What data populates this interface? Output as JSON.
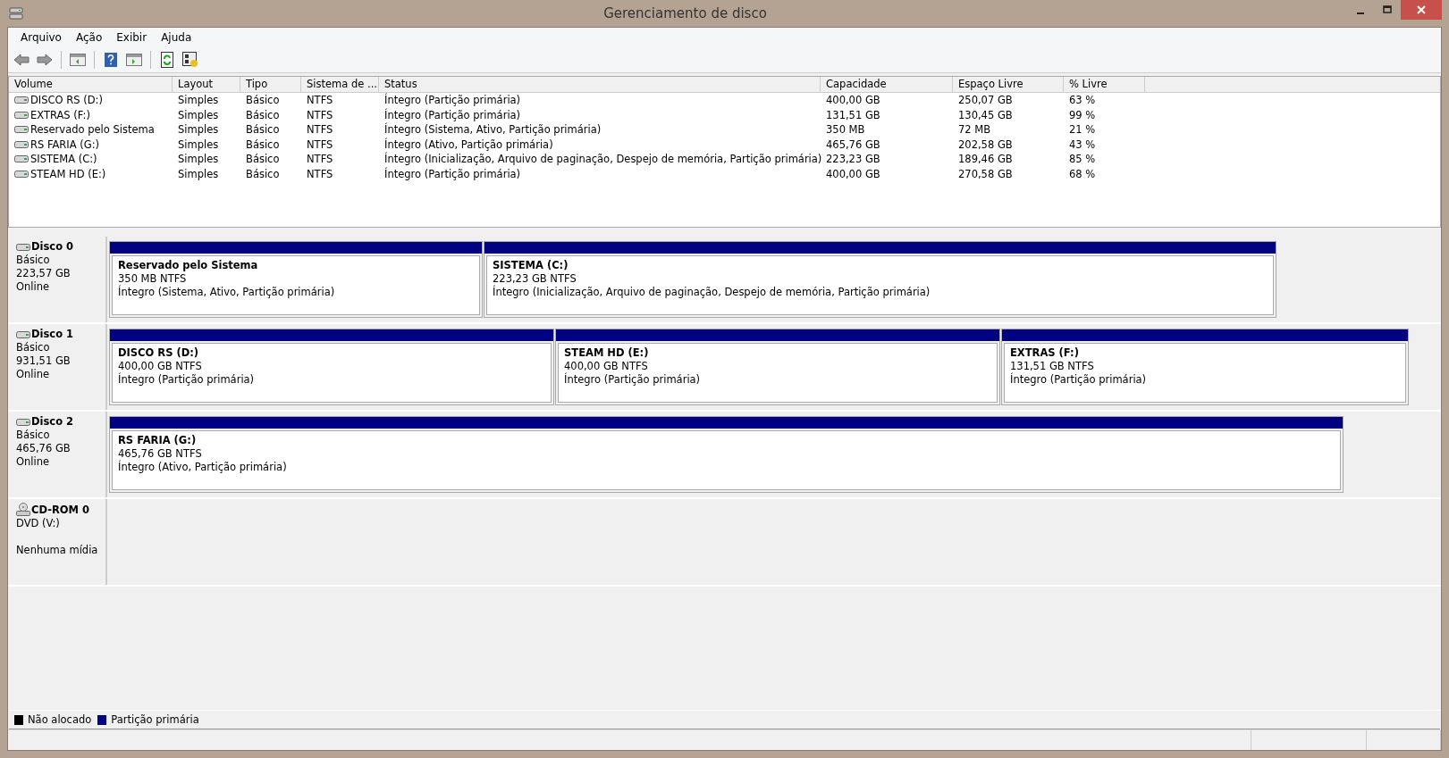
{
  "window": {
    "title": "Gerenciamento de disco"
  },
  "menu": [
    "Arquivo",
    "Ação",
    "Exibir",
    "Ajuda"
  ],
  "table": {
    "columns": [
      "Volume",
      "Layout",
      "Tipo",
      "Sistema de ...",
      "Status",
      "Capacidade",
      "Espaço Livre",
      "% Livre"
    ],
    "rows": [
      [
        "DISCO RS (D:)",
        "Simples",
        "Básico",
        "NTFS",
        "Íntegro (Partição primária)",
        "400,00 GB",
        "250,07 GB",
        "63 %"
      ],
      [
        "EXTRAS (F:)",
        "Simples",
        "Básico",
        "NTFS",
        "Íntegro (Partição primária)",
        "131,51 GB",
        "130,45 GB",
        "99 %"
      ],
      [
        "Reservado pelo Sistema",
        "Simples",
        "Básico",
        "NTFS",
        "Íntegro (Sistema, Ativo, Partição primária)",
        "350 MB",
        "72 MB",
        "21 %"
      ],
      [
        "RS FARIA (G:)",
        "Simples",
        "Básico",
        "NTFS",
        "Íntegro (Ativo, Partição primária)",
        "465,76 GB",
        "202,58 GB",
        "43 %"
      ],
      [
        "SISTEMA (C:)",
        "Simples",
        "Básico",
        "NTFS",
        "Íntegro (Inicialização, Arquivo de paginação, Despejo de memória, Partição primária)",
        "223,23 GB",
        "189,46 GB",
        "85 %"
      ],
      [
        "STEAM HD (E:)",
        "Simples",
        "Básico",
        "NTFS",
        "Íntegro (Partição primária)",
        "400,00 GB",
        "270,58 GB",
        "68 %"
      ]
    ]
  },
  "disks": [
    {
      "kind": "disk",
      "name": "Disco 0",
      "lines": [
        "Básico",
        "223,57 GB",
        "Online"
      ],
      "partitions": [
        {
          "name": "Reservado pelo Sistema",
          "size": "350 MB NTFS",
          "status": "Íntegro (Sistema, Ativo, Partição primária)"
        },
        {
          "name": "SISTEMA  (C:)",
          "size": "223,23 GB NTFS",
          "status": "Íntegro (Inicialização, Arquivo de paginação, Despejo de memória, Partição primária)"
        }
      ]
    },
    {
      "kind": "disk",
      "name": "Disco 1",
      "lines": [
        "Básico",
        "931,51 GB",
        "Online"
      ],
      "partitions": [
        {
          "name": "DISCO RS  (D:)",
          "size": "400,00 GB NTFS",
          "status": "Íntegro (Partição primária)"
        },
        {
          "name": "STEAM HD  (E:)",
          "size": "400,00 GB NTFS",
          "status": "Íntegro (Partição primária)"
        },
        {
          "name": "EXTRAS  (F:)",
          "size": "131,51 GB NTFS",
          "status": "Íntegro (Partição primária)"
        }
      ]
    },
    {
      "kind": "disk",
      "name": "Disco 2",
      "lines": [
        "Básico",
        "465,76 GB",
        "Online"
      ],
      "partitions": [
        {
          "name": "RS FARIA  (G:)",
          "size": "465,76 GB NTFS",
          "status": "Íntegro (Ativo, Partição primária)"
        }
      ]
    },
    {
      "kind": "cdrom",
      "name": "CD-ROM 0",
      "lines": [
        "DVD (V:)",
        "Nenhuma mídia"
      ]
    }
  ],
  "legend": [
    {
      "label": "Não alocado",
      "color": "#000000"
    },
    {
      "label": "Partição primária",
      "color": "#000080"
    }
  ]
}
